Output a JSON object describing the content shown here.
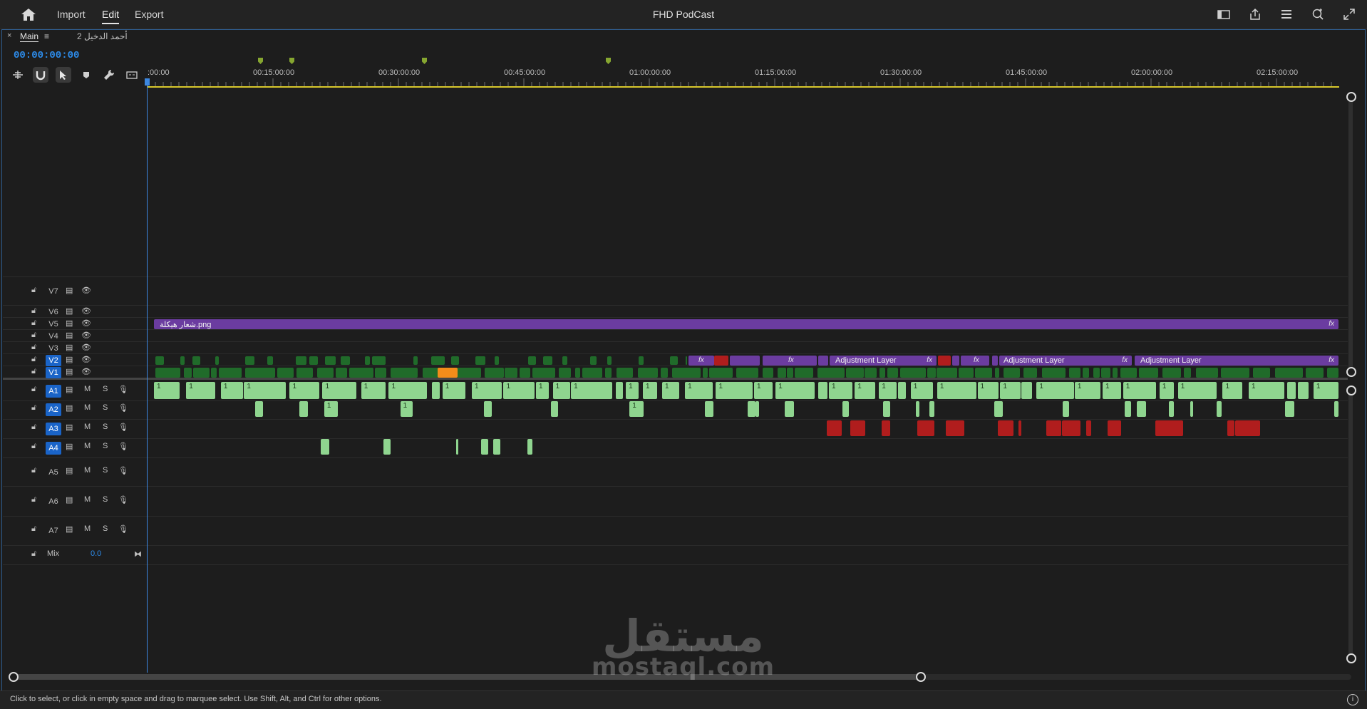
{
  "topbar": {
    "menu": [
      "Import",
      "Edit",
      "Export"
    ],
    "active_menu": "Edit",
    "title": "FHD PodCast",
    "icons": [
      "home-icon",
      "workspace-panel-icon",
      "share-icon",
      "list-icon",
      "zoom-icon",
      "fullscreen-icon"
    ]
  },
  "sequence_tabs": [
    {
      "label": "Main",
      "active": true
    },
    {
      "label": "أحمد الدخيل 2",
      "active": false
    }
  ],
  "timecode": "00:00:00:00",
  "ruler_labels": [
    ":00:00",
    "00:15:00:00",
    "00:30:00:00",
    "00:45:00:00",
    "01:00:00:00",
    "01:15:00:00",
    "01:30:00:00",
    "01:45:00:00",
    "02:00:00:00",
    "02:15:00:00"
  ],
  "video_tracks": [
    {
      "name": "V7",
      "selected": false
    },
    {
      "name": "V6",
      "selected": false
    },
    {
      "name": "V5",
      "selected": false
    },
    {
      "name": "V4",
      "selected": false
    },
    {
      "name": "V3",
      "selected": false
    },
    {
      "name": "V2",
      "selected": true
    },
    {
      "name": "V1",
      "selected": true
    }
  ],
  "audio_tracks": [
    {
      "name": "A1",
      "selected": true,
      "m": "M",
      "s": "S"
    },
    {
      "name": "A2",
      "selected": true,
      "m": "M",
      "s": "S"
    },
    {
      "name": "A3",
      "selected": true,
      "m": "M",
      "s": "S"
    },
    {
      "name": "A4",
      "selected": true,
      "m": "M",
      "s": "S"
    },
    {
      "name": "A5",
      "selected": false,
      "m": "M",
      "s": "S"
    },
    {
      "name": "A6",
      "selected": false,
      "m": "M",
      "s": "S"
    },
    {
      "name": "A7",
      "selected": false,
      "m": "M",
      "s": "S"
    }
  ],
  "mix": {
    "label": "Mix",
    "value": "0.0"
  },
  "clips": {
    "v5_logo": "شعار هيكلة.png",
    "adjustment_layer": "Adjustment Layer",
    "fx": "fx",
    "audio_channel": "1"
  },
  "status": "Click to select, or click in empty space and drag to marquee select. Use Shift, Alt, and Ctrl for other options.",
  "watermark": {
    "arabic": "مستقل",
    "latin": "mostaql.com"
  },
  "colors": {
    "accent": "#2d8ceb",
    "purple_clip": "#6b3ca0",
    "video_clip": "#206b2a",
    "audio_clip": "#8fd58f",
    "red_clip": "#b01d1d",
    "ruler_yellow": "#d8c82c"
  }
}
